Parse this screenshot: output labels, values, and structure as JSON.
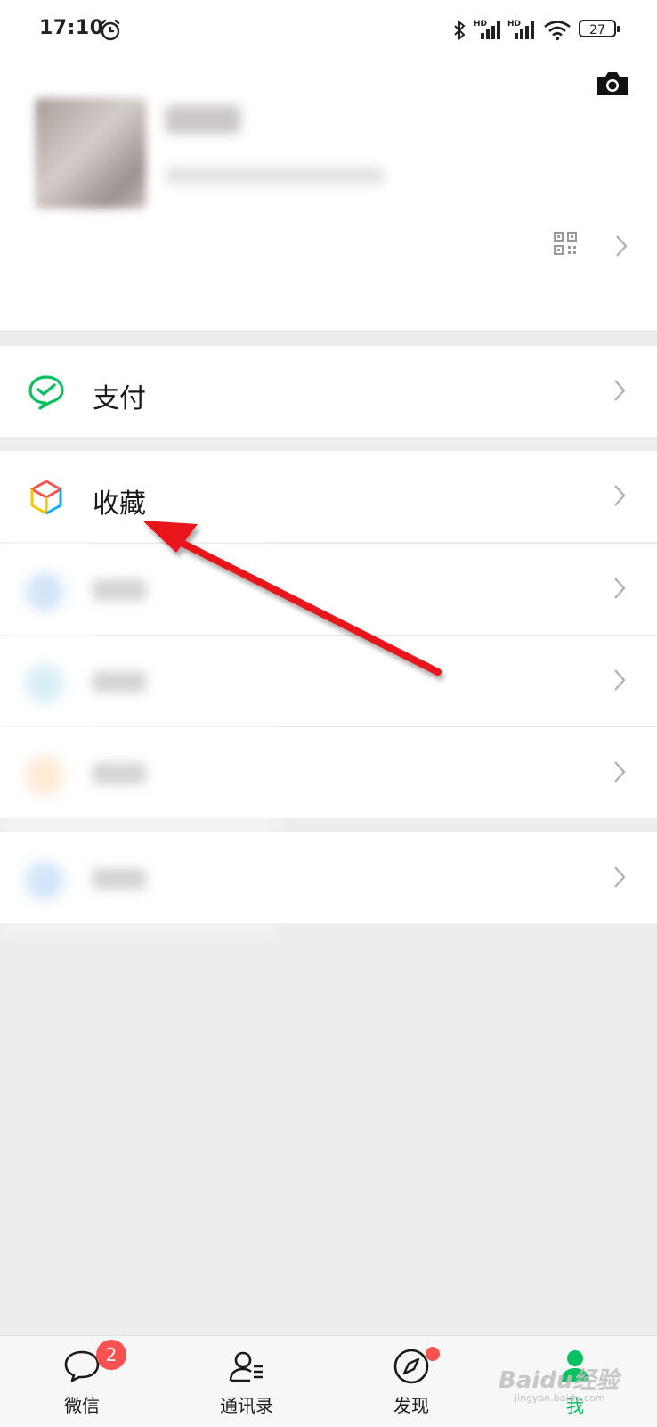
{
  "status_bar": {
    "time": "17:10",
    "battery": "27",
    "icons": [
      "alarm-icon",
      "bluetooth-icon",
      "signal-hd-icon",
      "signal-hd-icon",
      "wifi-icon",
      "battery-icon"
    ]
  },
  "header": {
    "camera_icon": "camera-icon"
  },
  "profile": {
    "qr_icon": "qr-code-icon",
    "chevron": "chevron-right-icon"
  },
  "menu": {
    "pay": {
      "label": "支付",
      "icon": "wechat-pay-icon"
    },
    "favorites": {
      "label": "收藏",
      "icon": "favorites-cube-icon"
    }
  },
  "annotation": {
    "color": "#e8141a"
  },
  "bottom_nav": {
    "tabs": [
      {
        "label": "微信",
        "icon": "chat-bubble-icon",
        "badge": "2"
      },
      {
        "label": "通讯录",
        "icon": "contacts-icon"
      },
      {
        "label": "发现",
        "icon": "compass-icon"
      },
      {
        "label": "我",
        "icon": "person-icon"
      }
    ]
  },
  "watermark": {
    "text": "Baidu经验",
    "sub": "jingyan.baidu.com"
  },
  "colors": {
    "accent": "#07c160",
    "badge": "#fa5151",
    "background": "#ededed"
  }
}
